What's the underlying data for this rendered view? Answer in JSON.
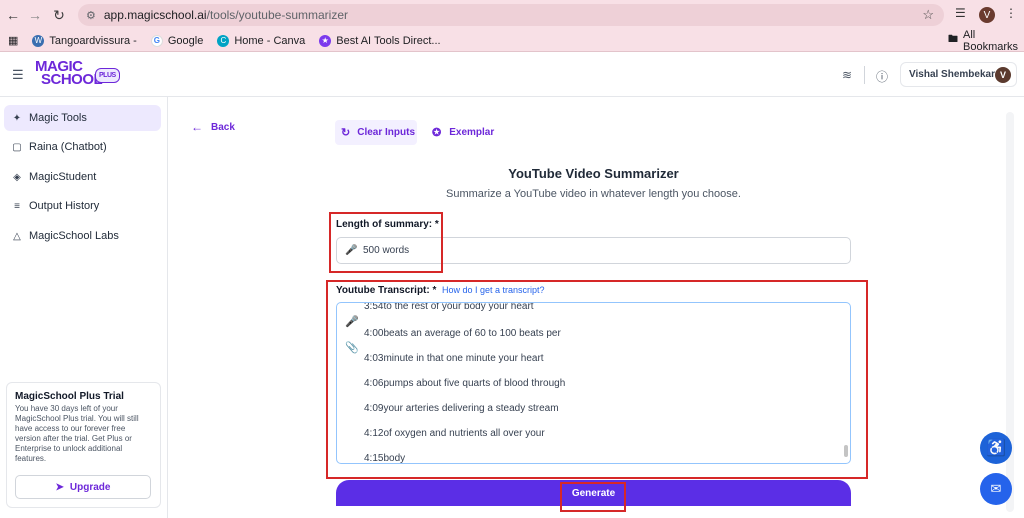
{
  "browser": {
    "url_host": "app.magicschool.ai",
    "url_path": "/tools/youtube-summarizer",
    "profile_initial": "V",
    "bookmarks": [
      {
        "label": "Tangoardvissura -"
      },
      {
        "label": "Google"
      },
      {
        "label": "Home - Canva"
      },
      {
        "label": "Best AI Tools Direct..."
      }
    ],
    "all_bookmarks": "All Bookmarks"
  },
  "header": {
    "logo_line1": "MAGIC",
    "logo_line2": "SCHOOL",
    "logo_badge": "PLUS",
    "user_name": "Vishal Shembekar",
    "user_initial": "V"
  },
  "sidebar": {
    "items": [
      {
        "label": "Magic Tools",
        "icon": "wand-icon"
      },
      {
        "label": "Raina (Chatbot)",
        "icon": "chat-icon"
      },
      {
        "label": "MagicStudent",
        "icon": "graduation-cap-icon"
      },
      {
        "label": "Output History",
        "icon": "history-icon"
      },
      {
        "label": "MagicSchool Labs",
        "icon": "flask-icon"
      }
    ],
    "trial": {
      "title": "MagicSchool Plus Trial",
      "body": "You have 30 days left of your MagicSchool Plus trial. You will still have access to our forever free version after the trial. Get Plus or Enterprise to unlock additional features.",
      "button": "Upgrade"
    }
  },
  "main": {
    "back": "Back",
    "clear_inputs": "Clear Inputs",
    "exemplar": "Exemplar",
    "title": "YouTube Video Summarizer",
    "subtitle": "Summarize a YouTube video in whatever length you choose.",
    "length_label": "Length of summary:",
    "length_value": "500 words",
    "transcript_label": "Youtube Transcript:",
    "transcript_help": "How do I get a transcript?",
    "required_mark": "*",
    "transcript_lines": [
      "3:54to the rest of your body your heart",
      "4:00beats an average of 60 to 100 beats per",
      "4:03minute in that one minute your heart",
      "4:06pumps about five quarts of blood through",
      "4:09your arteries delivering a steady stream",
      "4:12of oxygen and nutrients all over your",
      "4:15body"
    ],
    "generate": "Generate"
  },
  "colors": {
    "accent": "#6d28d9",
    "generate_bg": "#5b2ee6",
    "highlight": "#d62828"
  }
}
